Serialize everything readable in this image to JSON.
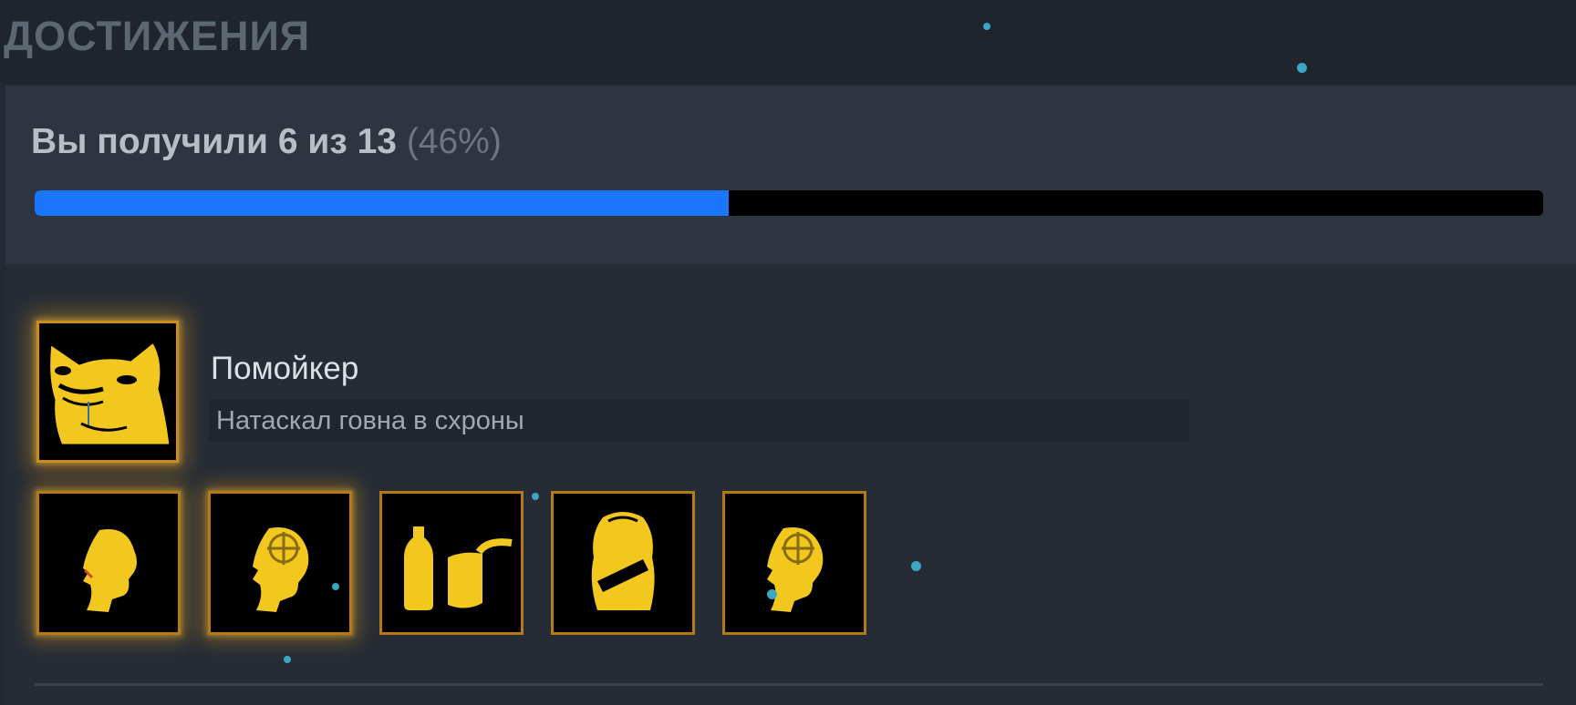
{
  "section": {
    "title": "ДОСТИЖЕНИЯ"
  },
  "progress": {
    "summary": "Вы получили 6 из 13",
    "percent_text": "(46%)",
    "earned": 6,
    "total": 13,
    "fraction": 0.46,
    "fill_color": "#1a76ff",
    "track_color": "#000000"
  },
  "featured_achievement": {
    "title": "Помойкер",
    "description": "Натаскал говна в схроны",
    "icon": "gold-cat-meme-icon"
  },
  "badges": [
    {
      "icon": "head-profile-icon"
    },
    {
      "icon": "head-crosshair-icon"
    },
    {
      "icon": "bottle-and-can-icon"
    },
    {
      "icon": "backpack-icon"
    },
    {
      "icon": "head-crosshair-icon"
    }
  ],
  "colors": {
    "gold": "#f2c81e",
    "gold_border": "#cc8d1a"
  }
}
